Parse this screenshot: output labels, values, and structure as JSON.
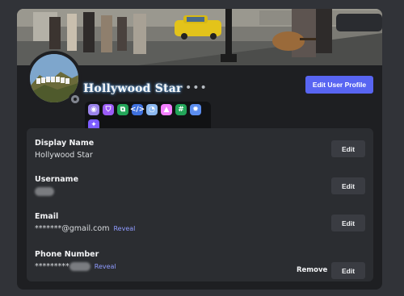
{
  "profile": {
    "display_name_header": "Hollywood Star",
    "more_options": "•••",
    "edit_profile_label": "Edit User Profile"
  },
  "badges": [
    {
      "icon": "hypesquad-icon",
      "color": "#9b84ec",
      "glyph": "◉"
    },
    {
      "icon": "shield-icon",
      "color": "#9b5cf6",
      "glyph": "⛉"
    },
    {
      "icon": "active-developer-icon",
      "color": "#23a559",
      "glyph": "⧉"
    },
    {
      "icon": "developer-icon",
      "color": "#3e70dd",
      "glyph": "</>"
    },
    {
      "icon": "nitro-icon",
      "color": "#8bb8f0",
      "glyph": "◔"
    },
    {
      "icon": "triangle-icon",
      "color": "#f47fff",
      "glyph": "▲"
    },
    {
      "icon": "hash-icon",
      "color": "#23a559",
      "glyph": "#"
    },
    {
      "icon": "gear-badge-icon",
      "color": "#5b8def",
      "glyph": "✹"
    },
    {
      "icon": "compass-badge-icon",
      "color": "#7c5cff",
      "glyph": "✦"
    }
  ],
  "fields": {
    "display_name": {
      "label": "Display Name",
      "value": "Hollywood Star",
      "edit": "Edit"
    },
    "username": {
      "label": "Username",
      "edit": "Edit"
    },
    "email": {
      "label": "Email",
      "value": "*******@gmail.com",
      "reveal": "Reveal",
      "edit": "Edit"
    },
    "phone": {
      "label": "Phone Number",
      "value": "*********",
      "reveal": "Reveal",
      "remove": "Remove",
      "edit": "Edit"
    }
  },
  "colors": {
    "accent": "#5865f2",
    "background": "#313338",
    "card": "#1e1f22",
    "panel": "#2b2d31"
  }
}
